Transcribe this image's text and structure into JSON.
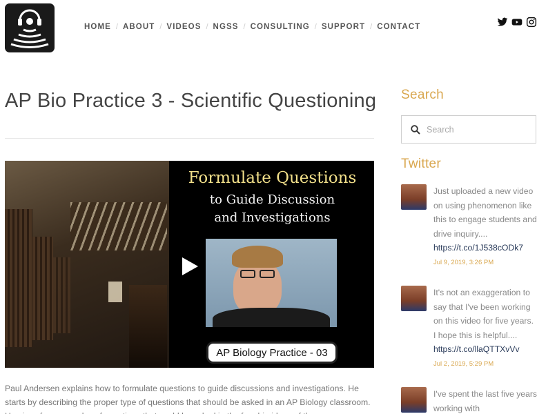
{
  "header": {
    "nav": [
      "HOME",
      "ABOUT",
      "VIDEOS",
      "NGSS",
      "CONSULTING",
      "SUPPORT",
      "CONTACT"
    ],
    "social_icons": [
      "twitter-icon",
      "youtube-icon",
      "instagram-icon"
    ]
  },
  "main": {
    "title": "AP Bio Practice 3 - Scientific Questioning",
    "video": {
      "heading_line1": "Formulate Questions",
      "heading_line2": "to Guide Discussion",
      "heading_line3": "and Investigations",
      "badge": "AP Biology Practice - 03"
    },
    "description": "Paul Andersen explains how to formulate questions to guide discussions and investigations. He starts by describing the proper type of questions that should be asked in an AP Biology classroom. He gives four examples of questions that could be asked in the four big ideas of the"
  },
  "sidebar": {
    "search_heading": "Search",
    "search_placeholder": "Search",
    "twitter_heading": "Twitter",
    "tweets": [
      {
        "text": "Just uploaded a new video on using phenomenon like this to engage students and drive inquiry....",
        "link": "https://t.co/1J538cODk7",
        "date": "Jul 9, 2019, 3:26 PM"
      },
      {
        "text": "It's not an exaggeration to say that I've been working on this video for five years. I hope this is helpful....",
        "link": "https://t.co/llaQTTXvVv",
        "date": "Jul 2, 2019, 5:29 PM"
      },
      {
        "text": "I've spent the last five years working with",
        "link": "",
        "date": ""
      }
    ]
  },
  "colors": {
    "accent": "#d9a74f",
    "link": "#2a3b5a",
    "text": "#777777"
  }
}
